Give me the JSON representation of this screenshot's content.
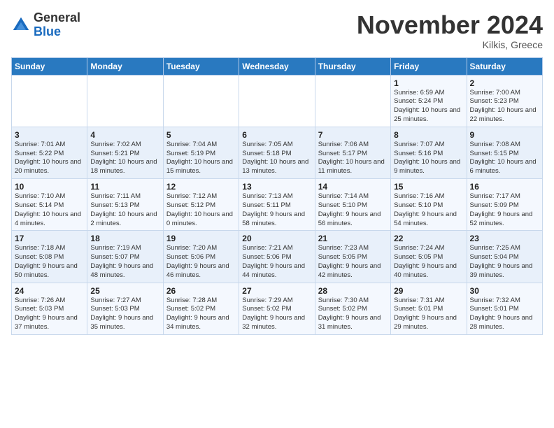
{
  "logo": {
    "general": "General",
    "blue": "Blue"
  },
  "title": "November 2024",
  "location": "Kilkis, Greece",
  "days_of_week": [
    "Sunday",
    "Monday",
    "Tuesday",
    "Wednesday",
    "Thursday",
    "Friday",
    "Saturday"
  ],
  "weeks": [
    [
      {
        "day": "",
        "info": ""
      },
      {
        "day": "",
        "info": ""
      },
      {
        "day": "",
        "info": ""
      },
      {
        "day": "",
        "info": ""
      },
      {
        "day": "",
        "info": ""
      },
      {
        "day": "1",
        "info": "Sunrise: 6:59 AM\nSunset: 5:24 PM\nDaylight: 10 hours\nand 25 minutes."
      },
      {
        "day": "2",
        "info": "Sunrise: 7:00 AM\nSunset: 5:23 PM\nDaylight: 10 hours\nand 22 minutes."
      }
    ],
    [
      {
        "day": "3",
        "info": "Sunrise: 7:01 AM\nSunset: 5:22 PM\nDaylight: 10 hours\nand 20 minutes."
      },
      {
        "day": "4",
        "info": "Sunrise: 7:02 AM\nSunset: 5:21 PM\nDaylight: 10 hours\nand 18 minutes."
      },
      {
        "day": "5",
        "info": "Sunrise: 7:04 AM\nSunset: 5:19 PM\nDaylight: 10 hours\nand 15 minutes."
      },
      {
        "day": "6",
        "info": "Sunrise: 7:05 AM\nSunset: 5:18 PM\nDaylight: 10 hours\nand 13 minutes."
      },
      {
        "day": "7",
        "info": "Sunrise: 7:06 AM\nSunset: 5:17 PM\nDaylight: 10 hours\nand 11 minutes."
      },
      {
        "day": "8",
        "info": "Sunrise: 7:07 AM\nSunset: 5:16 PM\nDaylight: 10 hours\nand 9 minutes."
      },
      {
        "day": "9",
        "info": "Sunrise: 7:08 AM\nSunset: 5:15 PM\nDaylight: 10 hours\nand 6 minutes."
      }
    ],
    [
      {
        "day": "10",
        "info": "Sunrise: 7:10 AM\nSunset: 5:14 PM\nDaylight: 10 hours\nand 4 minutes."
      },
      {
        "day": "11",
        "info": "Sunrise: 7:11 AM\nSunset: 5:13 PM\nDaylight: 10 hours\nand 2 minutes."
      },
      {
        "day": "12",
        "info": "Sunrise: 7:12 AM\nSunset: 5:12 PM\nDaylight: 10 hours\nand 0 minutes."
      },
      {
        "day": "13",
        "info": "Sunrise: 7:13 AM\nSunset: 5:11 PM\nDaylight: 9 hours\nand 58 minutes."
      },
      {
        "day": "14",
        "info": "Sunrise: 7:14 AM\nSunset: 5:10 PM\nDaylight: 9 hours\nand 56 minutes."
      },
      {
        "day": "15",
        "info": "Sunrise: 7:16 AM\nSunset: 5:10 PM\nDaylight: 9 hours\nand 54 minutes."
      },
      {
        "day": "16",
        "info": "Sunrise: 7:17 AM\nSunset: 5:09 PM\nDaylight: 9 hours\nand 52 minutes."
      }
    ],
    [
      {
        "day": "17",
        "info": "Sunrise: 7:18 AM\nSunset: 5:08 PM\nDaylight: 9 hours\nand 50 minutes."
      },
      {
        "day": "18",
        "info": "Sunrise: 7:19 AM\nSunset: 5:07 PM\nDaylight: 9 hours\nand 48 minutes."
      },
      {
        "day": "19",
        "info": "Sunrise: 7:20 AM\nSunset: 5:06 PM\nDaylight: 9 hours\nand 46 minutes."
      },
      {
        "day": "20",
        "info": "Sunrise: 7:21 AM\nSunset: 5:06 PM\nDaylight: 9 hours\nand 44 minutes."
      },
      {
        "day": "21",
        "info": "Sunrise: 7:23 AM\nSunset: 5:05 PM\nDaylight: 9 hours\nand 42 minutes."
      },
      {
        "day": "22",
        "info": "Sunrise: 7:24 AM\nSunset: 5:05 PM\nDaylight: 9 hours\nand 40 minutes."
      },
      {
        "day": "23",
        "info": "Sunrise: 7:25 AM\nSunset: 5:04 PM\nDaylight: 9 hours\nand 39 minutes."
      }
    ],
    [
      {
        "day": "24",
        "info": "Sunrise: 7:26 AM\nSunset: 5:03 PM\nDaylight: 9 hours\nand 37 minutes."
      },
      {
        "day": "25",
        "info": "Sunrise: 7:27 AM\nSunset: 5:03 PM\nDaylight: 9 hours\nand 35 minutes."
      },
      {
        "day": "26",
        "info": "Sunrise: 7:28 AM\nSunset: 5:02 PM\nDaylight: 9 hours\nand 34 minutes."
      },
      {
        "day": "27",
        "info": "Sunrise: 7:29 AM\nSunset: 5:02 PM\nDaylight: 9 hours\nand 32 minutes."
      },
      {
        "day": "28",
        "info": "Sunrise: 7:30 AM\nSunset: 5:02 PM\nDaylight: 9 hours\nand 31 minutes."
      },
      {
        "day": "29",
        "info": "Sunrise: 7:31 AM\nSunset: 5:01 PM\nDaylight: 9 hours\nand 29 minutes."
      },
      {
        "day": "30",
        "info": "Sunrise: 7:32 AM\nSunset: 5:01 PM\nDaylight: 9 hours\nand 28 minutes."
      }
    ]
  ]
}
